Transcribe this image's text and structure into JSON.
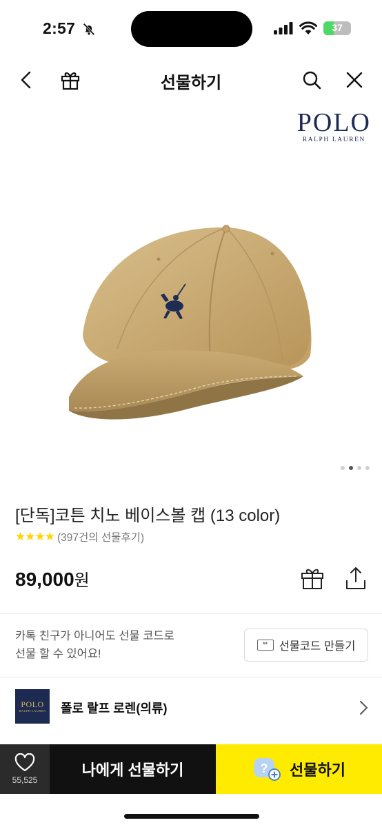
{
  "status_bar": {
    "time": "2:57",
    "battery": "37",
    "battery_level": 0.37
  },
  "header": {
    "title": "선물하기"
  },
  "hero": {
    "brand_wordmark": "POLO",
    "brand_subline": "RALPH LAUREN",
    "image": "beige-baseball-cap",
    "pager_total": 4,
    "pager_active": 2
  },
  "product": {
    "title": "[단독]코튼 치노 베이스볼 캡 (13 color)",
    "stars": "★★★★",
    "rating_value": 4,
    "review_text": "(397건의 선물후기)",
    "price": "89,000",
    "currency": "원"
  },
  "gift_code": {
    "message_line1": "카톡 친구가 아니어도 선물 코드로",
    "message_line2": "선물 할 수 있어요!",
    "button_label": "선물코드 만들기",
    "ticket_glyph": "**"
  },
  "brand": {
    "name": "폴로 랄프 로렌(의류)",
    "logo_word": "POLO",
    "logo_sub": "RALPH LAUREN"
  },
  "bottom_bar": {
    "like_count": "55,525",
    "self_gift_label": "나에게 선물하기",
    "gift_label": "선물하기",
    "gift_icon_glyph": "?"
  },
  "colors": {
    "accent": "#FFEB00",
    "dark": "#111111",
    "star": "#FFD400",
    "polo_navy": "#1D2B53"
  }
}
